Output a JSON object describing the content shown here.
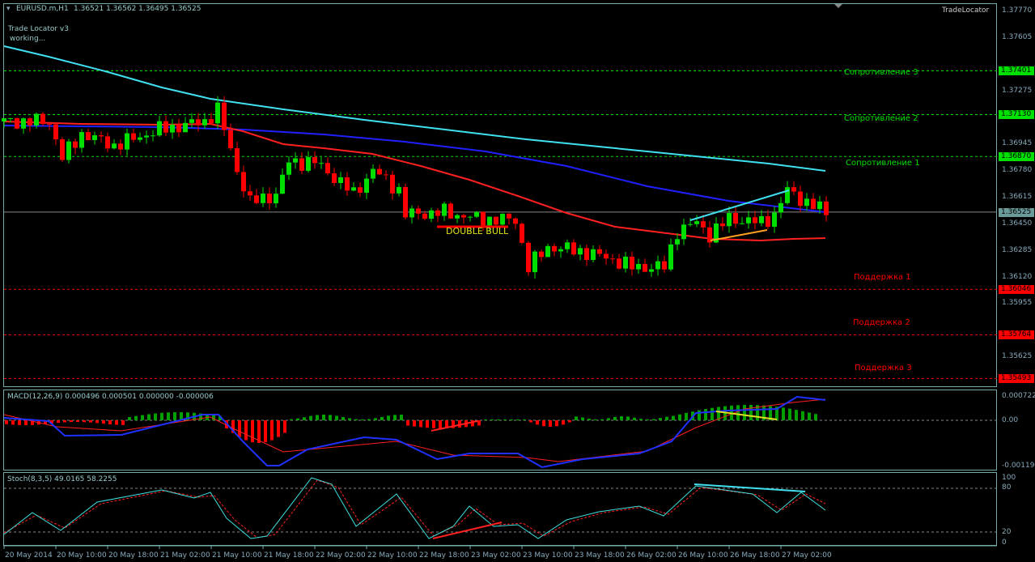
{
  "header": {
    "symbol": "EURUSD.m,H1",
    "ohlc": "1.36521 1.36562 1.36495 1.36525",
    "indicator_name": "Trade Locator v3",
    "indicator_status": "working...",
    "corner_label": "TradeLocator"
  },
  "price_axis": {
    "ticks": [
      "1.37770",
      "1.37605",
      "1.37275",
      "1.36945",
      "1.36780",
      "1.36615",
      "1.36450",
      "1.36285",
      "1.36120",
      "1.35955",
      "1.35625"
    ],
    "tick_values": [
      1.3777,
      1.37605,
      1.37275,
      1.36945,
      1.3678,
      1.36615,
      1.3645,
      1.36285,
      1.3612,
      1.35955,
      1.35625
    ],
    "current": {
      "label": "1.36525",
      "value": 1.36525,
      "color": "#6a9a9a"
    }
  },
  "levels": [
    {
      "name": "Сопротивление 3",
      "price": "1.37401",
      "value": 1.37401,
      "color": "#00e000"
    },
    {
      "name": "Сопротивление 2",
      "price": "1.37130",
      "value": 1.3713,
      "color": "#00e000"
    },
    {
      "name": "Сопротивление 1",
      "price": "1.36870",
      "value": 1.3687,
      "color": "#00e000"
    },
    {
      "name": "Поддержка 1",
      "price": "1.36046",
      "value": 1.36046,
      "color": "#ff0000"
    },
    {
      "name": "Поддержка 2",
      "price": "1.35764",
      "value": 1.35764,
      "color": "#ff0000"
    },
    {
      "name": "Поддержка 3",
      "price": "1.35493",
      "value": 1.35493,
      "color": "#ff0000"
    }
  ],
  "price_range": [
    1.3546,
    1.3777
  ],
  "price_path": [
    [
      0,
      1.37087
    ],
    [
      7,
      1.37087
    ],
    [
      9,
      1.36861
    ],
    [
      12,
      1.37012
    ],
    [
      17,
      1.36937
    ],
    [
      24,
      1.37037
    ],
    [
      31,
      1.37087
    ],
    [
      33,
      1.37163
    ],
    [
      34,
      1.37037
    ],
    [
      36,
      1.36786
    ],
    [
      38,
      1.36585
    ],
    [
      42,
      1.36636
    ],
    [
      44,
      1.36836
    ],
    [
      48,
      1.36836
    ],
    [
      52,
      1.36711
    ],
    [
      54,
      1.36636
    ],
    [
      57,
      1.36786
    ],
    [
      61,
      1.36661
    ],
    [
      62,
      1.3651
    ],
    [
      68,
      1.36525
    ],
    [
      73,
      1.36485
    ],
    [
      79,
      1.36475
    ],
    [
      81,
      1.36184
    ],
    [
      84,
      1.36309
    ],
    [
      89,
      1.36284
    ],
    [
      94,
      1.36234
    ],
    [
      97,
      1.36184
    ],
    [
      102,
      1.36184
    ],
    [
      104,
      1.3641
    ],
    [
      107,
      1.3646
    ],
    [
      109,
      1.36385
    ],
    [
      112,
      1.36485
    ],
    [
      117,
      1.3646
    ],
    [
      119,
      1.3651
    ],
    [
      121,
      1.36661
    ],
    [
      124,
      1.36585
    ],
    [
      127,
      1.36525
    ]
  ],
  "pattern_label": "DOUBLE BULL",
  "macd": {
    "label": "MACD(12,26,9) 0.000496 0.000501 0.000000 -0.000006",
    "ticks": [
      "0.000722",
      "0.00",
      "-0.001193"
    ]
  },
  "stoch": {
    "label": "Stoch(8,3,5) 49.0165 58.2255",
    "ticks": [
      "100",
      "80",
      "20",
      "0"
    ]
  },
  "time_axis": [
    "20 May 2014",
    "20 May 10:00",
    "20 May 18:00",
    "21 May 02:00",
    "21 May 10:00",
    "21 May 18:00",
    "22 May 02:00",
    "22 May 10:00",
    "22 May 18:00",
    "23 May 02:00",
    "23 May 10:00",
    "23 May 18:00",
    "26 May 02:00",
    "26 May 10:00",
    "26 May 18:00",
    "27 May 02:00"
  ],
  "colors": {
    "bull": "#00e000",
    "bear": "#ff0000",
    "ma_fast": "#ff2020",
    "ma_mid": "#2020ff",
    "ma_slow": "#40e0f0"
  }
}
